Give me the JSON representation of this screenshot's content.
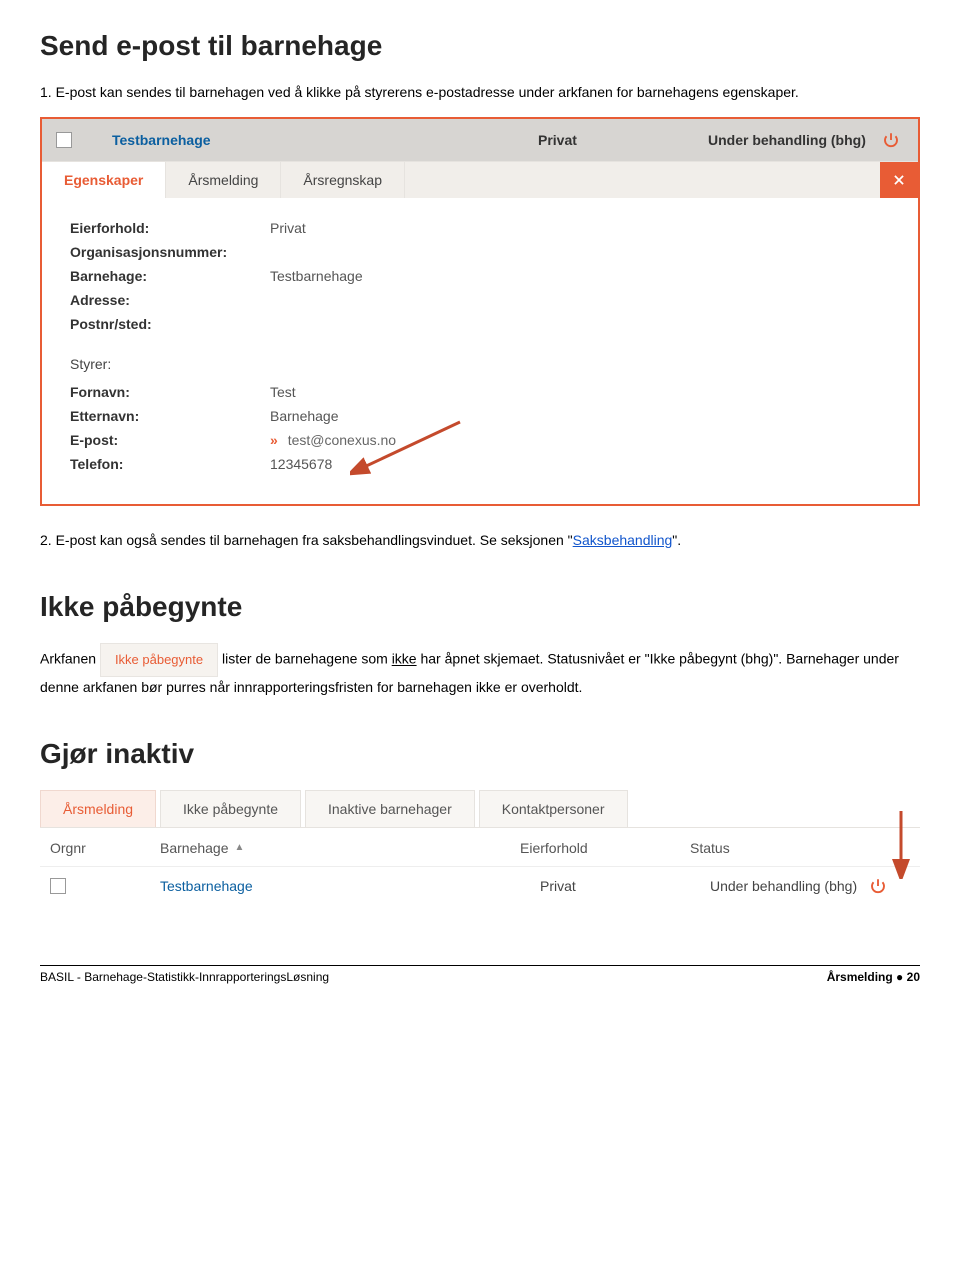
{
  "headings": {
    "main": "Send e-post til barnehage",
    "section2": "Ikke påbegynte",
    "section3": "Gjør inaktiv"
  },
  "paras": {
    "p1_pre": "1. E-post kan sendes til barnehagen ved å klikke på styrerens e-postadresse under arkfanen for barnehagens egenskaper.",
    "p2_pre": "2. E-post kan også sendes til barnehagen fra saksbehandlingsvinduet. Se seksjonen \"",
    "p2_link": "Saksbehandling",
    "p2_post": "\".",
    "p3_arkfanen": "Arkfanen",
    "p3_mid1": " lister de barnehagene som ",
    "p3_ikke": "ikke",
    "p3_mid2": " har åpnet skjemaet. Statusnivået er \"Ikke påbegynt (bhg)\". Barnehager under denne arkfanen bør purres når innrapporteringsfristen for barnehagen ikke er overholdt."
  },
  "panel1": {
    "header": {
      "name": "Testbarnehage",
      "mid": "Privat",
      "status": "Under behandling (bhg)"
    },
    "tabs": {
      "t1": "Egenskaper",
      "t2": "Årsmelding",
      "t3": "Årsregnskap"
    },
    "props": {
      "eierforhold_l": "Eierforhold:",
      "eierforhold_v": "Privat",
      "orgnr_l": "Organisasjonsnummer:",
      "orgnr_v": "",
      "bhg_l": "Barnehage:",
      "bhg_v": "Testbarnehage",
      "adresse_l": "Adresse:",
      "adresse_v": "",
      "post_l": "Postnr/sted:",
      "post_v": ""
    },
    "styrer": {
      "title": "Styrer:",
      "fornavn_l": "Fornavn:",
      "fornavn_v": "Test",
      "etternavn_l": "Etternavn:",
      "etternavn_v": "Barnehage",
      "epost_l": "E-post:",
      "epost_v": "test@conexus.no",
      "telefon_l": "Telefon:",
      "telefon_v": "12345678"
    }
  },
  "chip_ikke": "Ikke påbegynte",
  "panel2": {
    "tabs": {
      "t1": "Årsmelding",
      "t2": "Ikke påbegynte",
      "t3": "Inaktive barnehager",
      "t4": "Kontaktpersoner"
    },
    "cols": {
      "orgnr": "Orgnr",
      "bhg": "Barnehage",
      "eier": "Eierforhold",
      "status": "Status"
    },
    "row": {
      "name": "Testbarnehage",
      "eier": "Privat",
      "status": "Under behandling (bhg)"
    }
  },
  "footer": {
    "left": "BASIL - Barnehage-Statistikk-InnrapporteringsLøsning",
    "right_a": "Årsmelding",
    "right_b": "20"
  }
}
